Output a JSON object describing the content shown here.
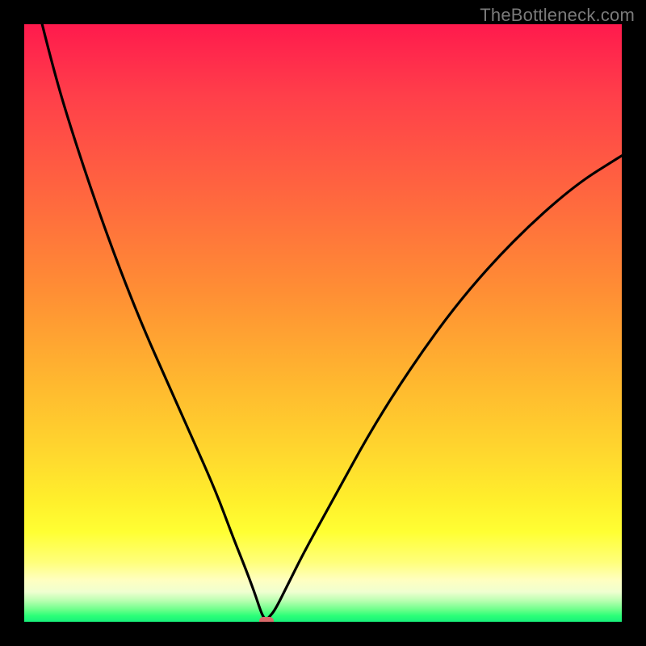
{
  "watermark": "TheBottleneck.com",
  "colors": {
    "background": "#000000",
    "watermark": "#7a7a7a",
    "curve": "#000000",
    "marker": "#d96a6a",
    "gradient_top": "#ff1a4d",
    "gradient_mid": "#ffd82e",
    "gradient_bottom": "#18f07a"
  },
  "chart_data": {
    "type": "line",
    "title": "",
    "xlabel": "",
    "ylabel": "",
    "x_range": [
      0,
      100
    ],
    "y_range": [
      0,
      100
    ],
    "grid": false,
    "legend": false,
    "marker": {
      "x": 40.5,
      "y": 0,
      "color": "#d96a6a"
    },
    "description": "V-shaped bottleneck curve with vertex near x≈40; left branch steeper than right; y goes off-scale at both x extremes",
    "series": [
      {
        "name": "bottleneck-curve",
        "color": "#000000",
        "x": [
          3,
          5,
          8,
          12,
          16,
          20,
          24,
          28,
          32,
          35,
          37,
          38.5,
          39.5,
          40,
          40.5,
          41,
          42,
          44,
          47,
          52,
          58,
          65,
          73,
          82,
          92,
          100
        ],
        "y": [
          100,
          92,
          82,
          70,
          59,
          49,
          40,
          31,
          22,
          14,
          9,
          5,
          2,
          0.8,
          0.3,
          0.8,
          2,
          6,
          12,
          21,
          32,
          43,
          54,
          64,
          73,
          78
        ]
      }
    ]
  }
}
